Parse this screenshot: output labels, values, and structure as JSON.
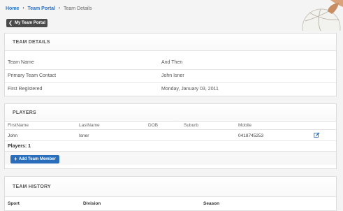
{
  "breadcrumb": {
    "home": "Home",
    "team_portal": "Team Portal",
    "current": "Team Details"
  },
  "back_button": {
    "label": "My Team Portal"
  },
  "team_details": {
    "title": "TEAM DETAILS",
    "rows": [
      {
        "label": "Team Name",
        "value": "And Then"
      },
      {
        "label": "Primary Team Contact",
        "value": "John Isner"
      },
      {
        "label": "First Registered",
        "value": "Monday, January 03, 2011"
      }
    ]
  },
  "players": {
    "title": "PLAYERS",
    "columns": [
      "FirstName",
      "LastName",
      "DOB",
      "Suburb",
      "Mobile"
    ],
    "rows": [
      {
        "first_name": "John",
        "last_name": "Isner",
        "dob": "",
        "suburb": "",
        "mobile": "0418745253"
      }
    ],
    "count_label": "Players: 1",
    "add_button": "Add Team Member"
  },
  "team_history": {
    "title": "TEAM HISTORY",
    "columns": [
      "Sport",
      "Division",
      "Season"
    ]
  },
  "colors": {
    "link": "#2a6ebb",
    "primary_button": "#2a6ebb",
    "dark_button": "#4a4a4a",
    "background": "#f4f4f4"
  },
  "icons": [
    "chevron-left-icon",
    "plus-icon",
    "edit-icon",
    "volleyball-image"
  ]
}
